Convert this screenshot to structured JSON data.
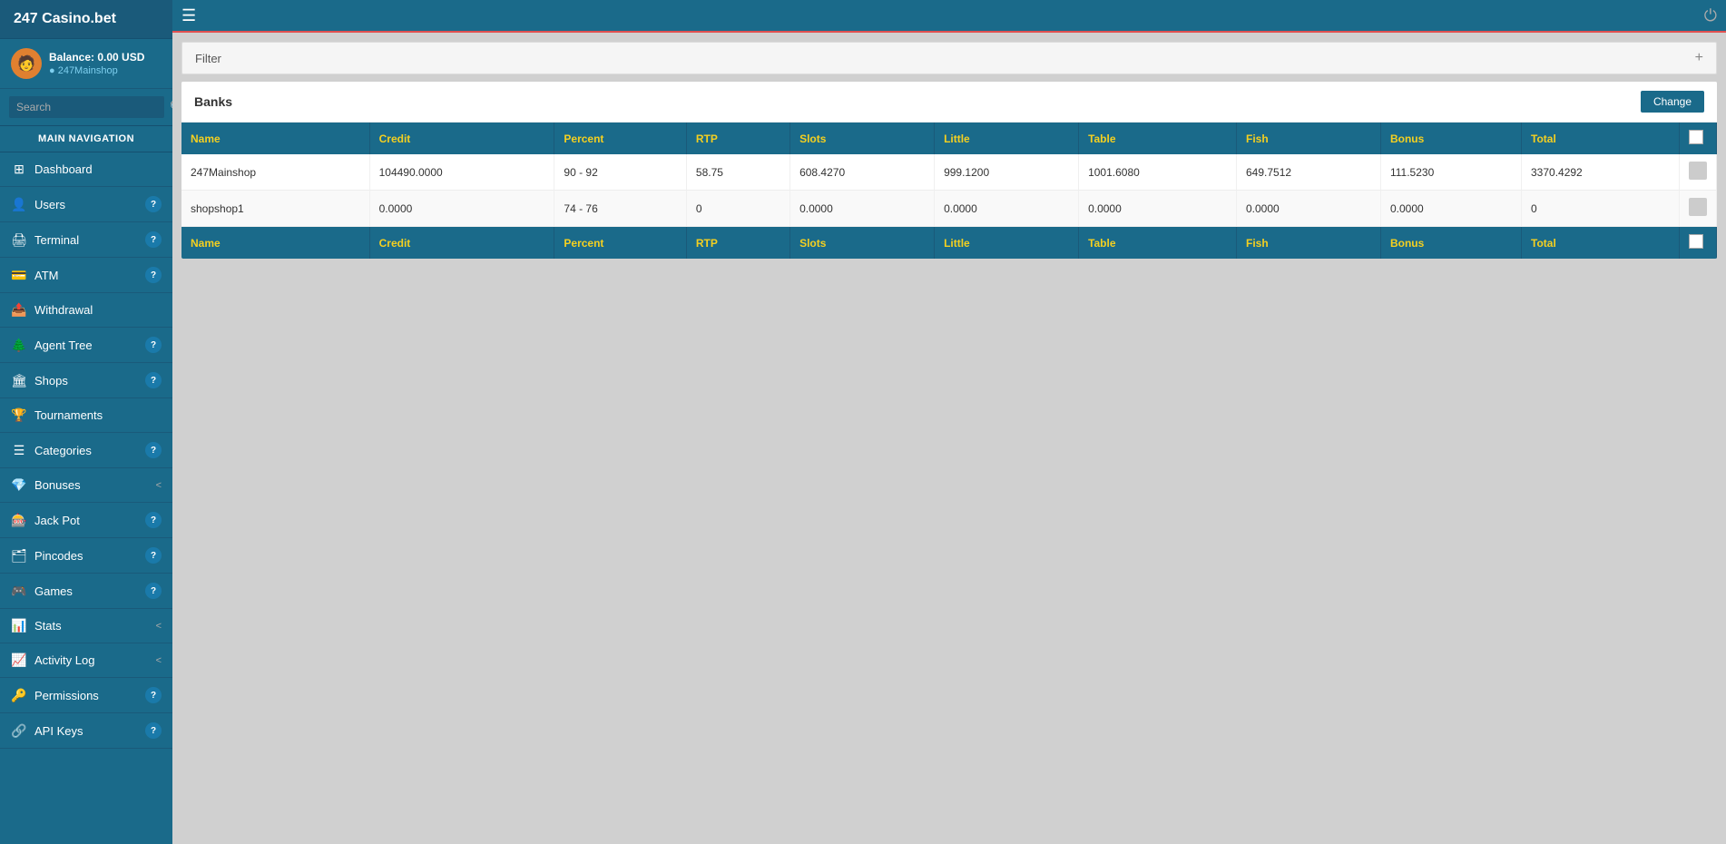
{
  "app": {
    "title": "247 Casino.bet"
  },
  "sidebar": {
    "user": {
      "balance": "Balance: 0.00 USD",
      "name": "247Mainshop"
    },
    "search_placeholder": "Search",
    "nav_title": "MAIN NAVIGATION",
    "items": [
      {
        "id": "dashboard",
        "label": "Dashboard",
        "icon": "⊞",
        "badge": null
      },
      {
        "id": "users",
        "label": "Users",
        "icon": "👤",
        "badge": "?"
      },
      {
        "id": "terminal",
        "label": "Terminal",
        "icon": "🖨",
        "badge": "?"
      },
      {
        "id": "atm",
        "label": "ATM",
        "icon": "💳",
        "badge": "?"
      },
      {
        "id": "withdrawal",
        "label": "Withdrawal",
        "icon": "📤",
        "badge": null
      },
      {
        "id": "agent-tree",
        "label": "Agent Tree",
        "icon": "🌲",
        "badge": "?"
      },
      {
        "id": "shops",
        "label": "Shops",
        "icon": "🏛",
        "badge": "?"
      },
      {
        "id": "tournaments",
        "label": "Tournaments",
        "icon": "🏆",
        "badge": null
      },
      {
        "id": "categories",
        "label": "Categories",
        "icon": "☰",
        "badge": "?"
      },
      {
        "id": "bonuses",
        "label": "Bonuses",
        "icon": "💎",
        "badge": null,
        "chevron": "<"
      },
      {
        "id": "jackpot",
        "label": "Jack Pot",
        "icon": "🎰",
        "badge": "?"
      },
      {
        "id": "pincodes",
        "label": "Pincodes",
        "icon": "🗂",
        "badge": "?"
      },
      {
        "id": "games",
        "label": "Games",
        "icon": "🎮",
        "badge": "?"
      },
      {
        "id": "stats",
        "label": "Stats",
        "icon": "📊",
        "badge": null,
        "chevron": "<"
      },
      {
        "id": "activity-log",
        "label": "Activity Log",
        "icon": "📈",
        "badge": null,
        "chevron": "<"
      },
      {
        "id": "permissions",
        "label": "Permissions",
        "icon": "🔑",
        "badge": "?"
      },
      {
        "id": "api-keys",
        "label": "API Keys",
        "icon": "🔗",
        "badge": "?"
      }
    ]
  },
  "filter": {
    "label": "Filter",
    "plus_icon": "+"
  },
  "banks": {
    "title": "Banks",
    "change_button": "Change",
    "columns": [
      "Name",
      "Credit",
      "Percent",
      "RTP",
      "Slots",
      "Little",
      "Table",
      "Fish",
      "Bonus",
      "Total",
      ""
    ],
    "rows": [
      {
        "name": "247Mainshop",
        "credit": "104490.0000",
        "percent": "90 - 92",
        "rtp": "58.75",
        "slots": "608.4270",
        "little": "999.1200",
        "table": "1001.6080",
        "fish": "649.7512",
        "bonus": "111.5230",
        "total": "3370.4292"
      },
      {
        "name": "shopshop1",
        "credit": "0.0000",
        "percent": "74 - 76",
        "rtp": "0",
        "slots": "0.0000",
        "little": "0.0000",
        "table": "0.0000",
        "fish": "0.0000",
        "bonus": "0.0000",
        "total": "0"
      }
    ]
  }
}
